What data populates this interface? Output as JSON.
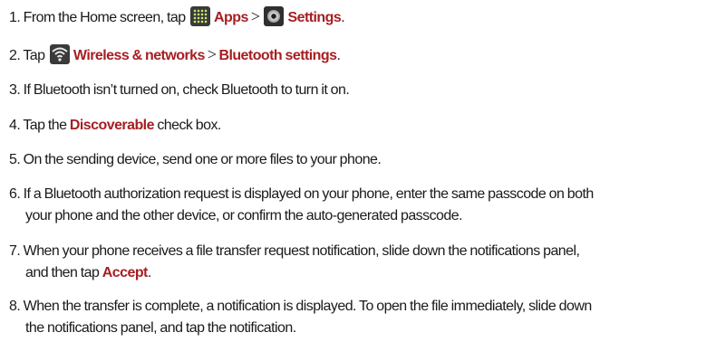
{
  "steps": [
    {
      "prefix": "1. From the Home screen, tap",
      "apps_label": "Apps",
      "sep": ">",
      "settings_label": "Settings",
      "suffix": "."
    },
    {
      "prefix": "2. Tap",
      "wireless_label": "Wireless & networks",
      "sep": ">",
      "bt_settings_label": "Bluetooth settings",
      "suffix": "."
    },
    {
      "text": "3. If Bluetooth isn’t turned on, check Bluetooth to turn it on."
    },
    {
      "prefix": "4. Tap the",
      "discoverable_label": "Discoverable",
      "suffix": "check box."
    },
    {
      "text": "5. On the sending device, send one or more files to your phone."
    },
    {
      "line1": "6. If a Bluetooth authorization request is displayed on your phone, enter the same passcode on both",
      "line2": "your phone and the other device, or confirm the auto-generated passcode."
    },
    {
      "line1": "7. When your phone receives a file transfer request notification, slide down the notifications panel,",
      "line2_prefix": "and then tap",
      "accept_label": "Accept",
      "line2_suffix": "."
    },
    {
      "line1": "8. When the transfer is complete, a notification is displayed. To open the file immediately, slide down",
      "line2": "the notifications panel, and tap the notification."
    }
  ],
  "icons": {
    "apps": "apps-grid-icon",
    "settings": "settings-gear-icon",
    "wireless": "wifi-signal-icon"
  },
  "colors": {
    "highlight": "#a61e22",
    "text": "#1a1a1a",
    "background": "#ffffff"
  }
}
